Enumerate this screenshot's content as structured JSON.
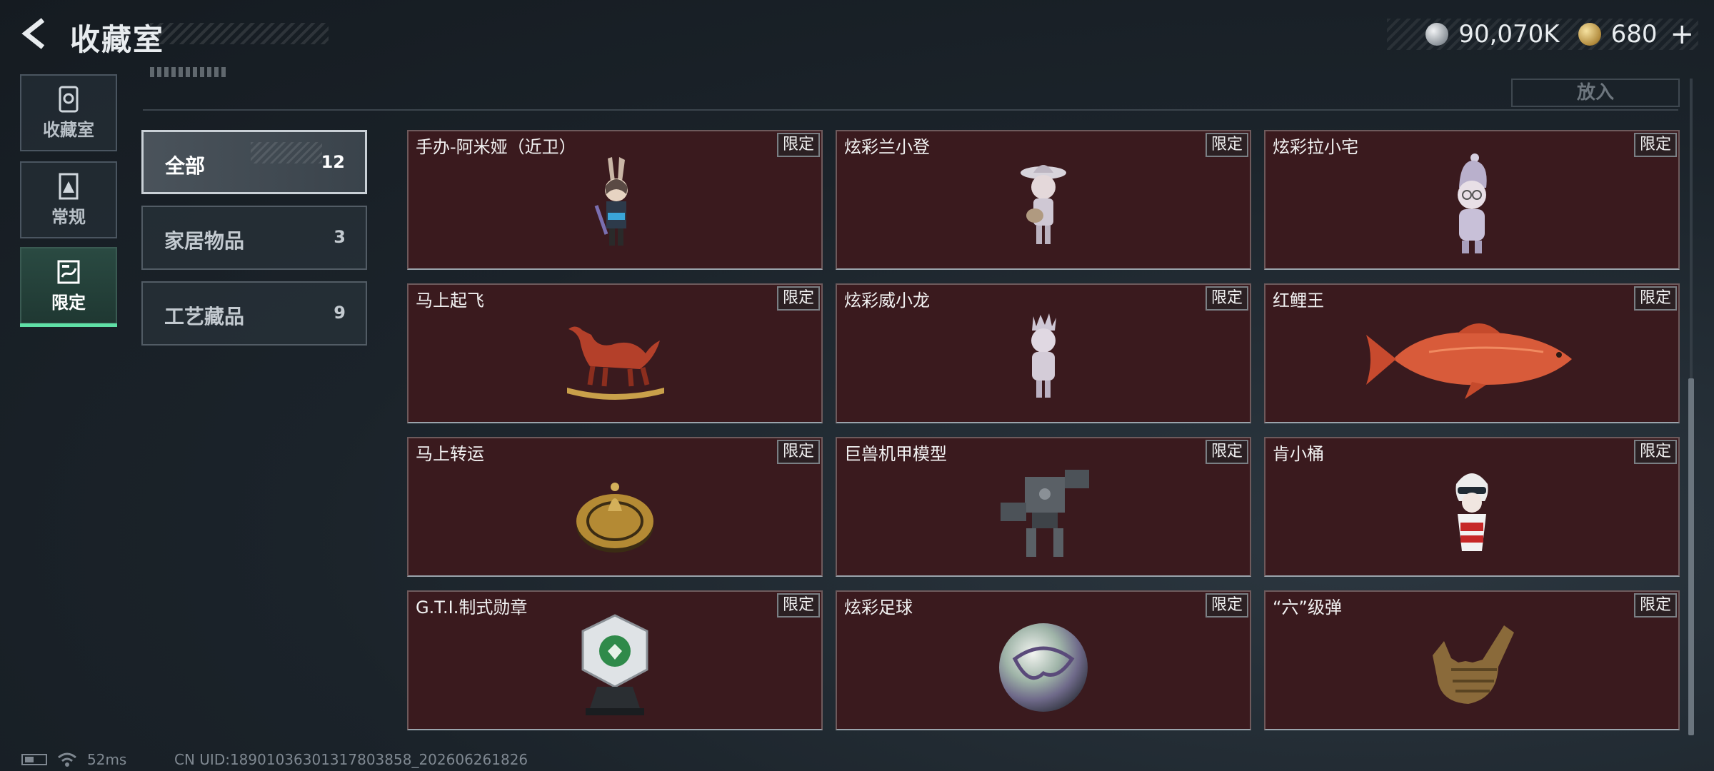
{
  "header": {
    "title": "收藏室",
    "currencies": [
      {
        "icon": "silver-coin-icon",
        "value": "90,070K"
      },
      {
        "icon": "gold-coin-icon",
        "value": "680"
      }
    ],
    "add_label": "+"
  },
  "sidebar": {
    "tabs": [
      {
        "label": "收藏室",
        "icon": "collection-icon",
        "active": false
      },
      {
        "label": "常规",
        "icon": "regular-icon",
        "active": false
      },
      {
        "label": "限定",
        "icon": "limited-icon",
        "active": true
      }
    ]
  },
  "toolbar": {
    "put_label": "放入"
  },
  "categories": [
    {
      "name": "全部",
      "count": "12",
      "active": true
    },
    {
      "name": "家居物品",
      "count": "3",
      "active": false
    },
    {
      "name": "工艺藏品",
      "count": "9",
      "active": false
    }
  ],
  "items": [
    {
      "name": "手办-阿米娅（近卫）",
      "tag": "限定",
      "icon": "figurine-icon"
    },
    {
      "name": "炫彩兰小登",
      "tag": "限定",
      "icon": "figurine-icon"
    },
    {
      "name": "炫彩拉小宅",
      "tag": "限定",
      "icon": "figurine-icon"
    },
    {
      "name": "马上起飞",
      "tag": "限定",
      "icon": "horse-icon"
    },
    {
      "name": "炫彩威小龙",
      "tag": "限定",
      "icon": "figurine-icon"
    },
    {
      "name": "红鲤王",
      "tag": "限定",
      "icon": "carp-icon"
    },
    {
      "name": "马上转运",
      "tag": "限定",
      "icon": "disc-icon"
    },
    {
      "name": "巨兽机甲模型",
      "tag": "限定",
      "icon": "mech-icon"
    },
    {
      "name": "肯小桶",
      "tag": "限定",
      "icon": "figurine-icon"
    },
    {
      "name": "G.T.I.制式勋章",
      "tag": "限定",
      "icon": "medal-icon"
    },
    {
      "name": "炫彩足球",
      "tag": "限定",
      "icon": "ball-icon"
    },
    {
      "name": "“六”级弹",
      "tag": "限定",
      "icon": "hand-icon"
    }
  ],
  "status": {
    "ping": "52ms",
    "uid": "CN UID:18901036301317803858_202606261826"
  },
  "colors": {
    "accent": "#5fe0a6",
    "card_bg": "#3a1a1e"
  }
}
